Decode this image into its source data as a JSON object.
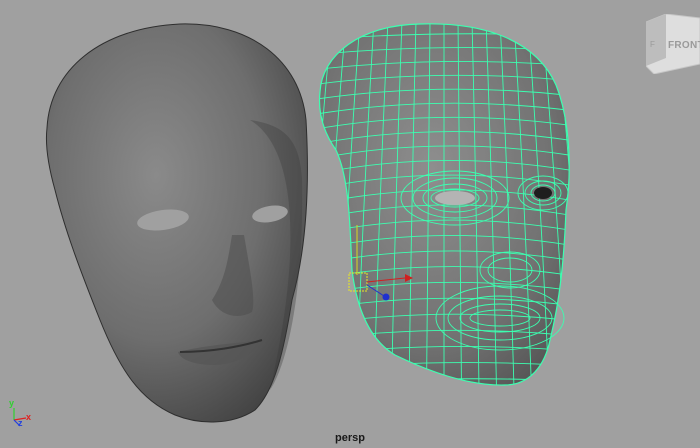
{
  "viewport": {
    "camera_label": "persp",
    "background": "#a0a0a0"
  },
  "viewcube": {
    "face_label": "FRONT",
    "icon": "view-cube-icon"
  },
  "axes": {
    "x_label": "x",
    "y_label": "y",
    "z_label": "z",
    "x_color": "#e02020",
    "y_color": "#30d030",
    "z_color": "#2040e0"
  },
  "objects": {
    "shaded_head": {
      "icon": "head-mesh-shaded",
      "color": "#6a6a6a"
    },
    "wireframe_head": {
      "icon": "head-mesh-wireframe",
      "wire_color": "#3cffb0",
      "selected": true
    },
    "manipulator": {
      "icon": "move-manipulator-icon"
    }
  }
}
